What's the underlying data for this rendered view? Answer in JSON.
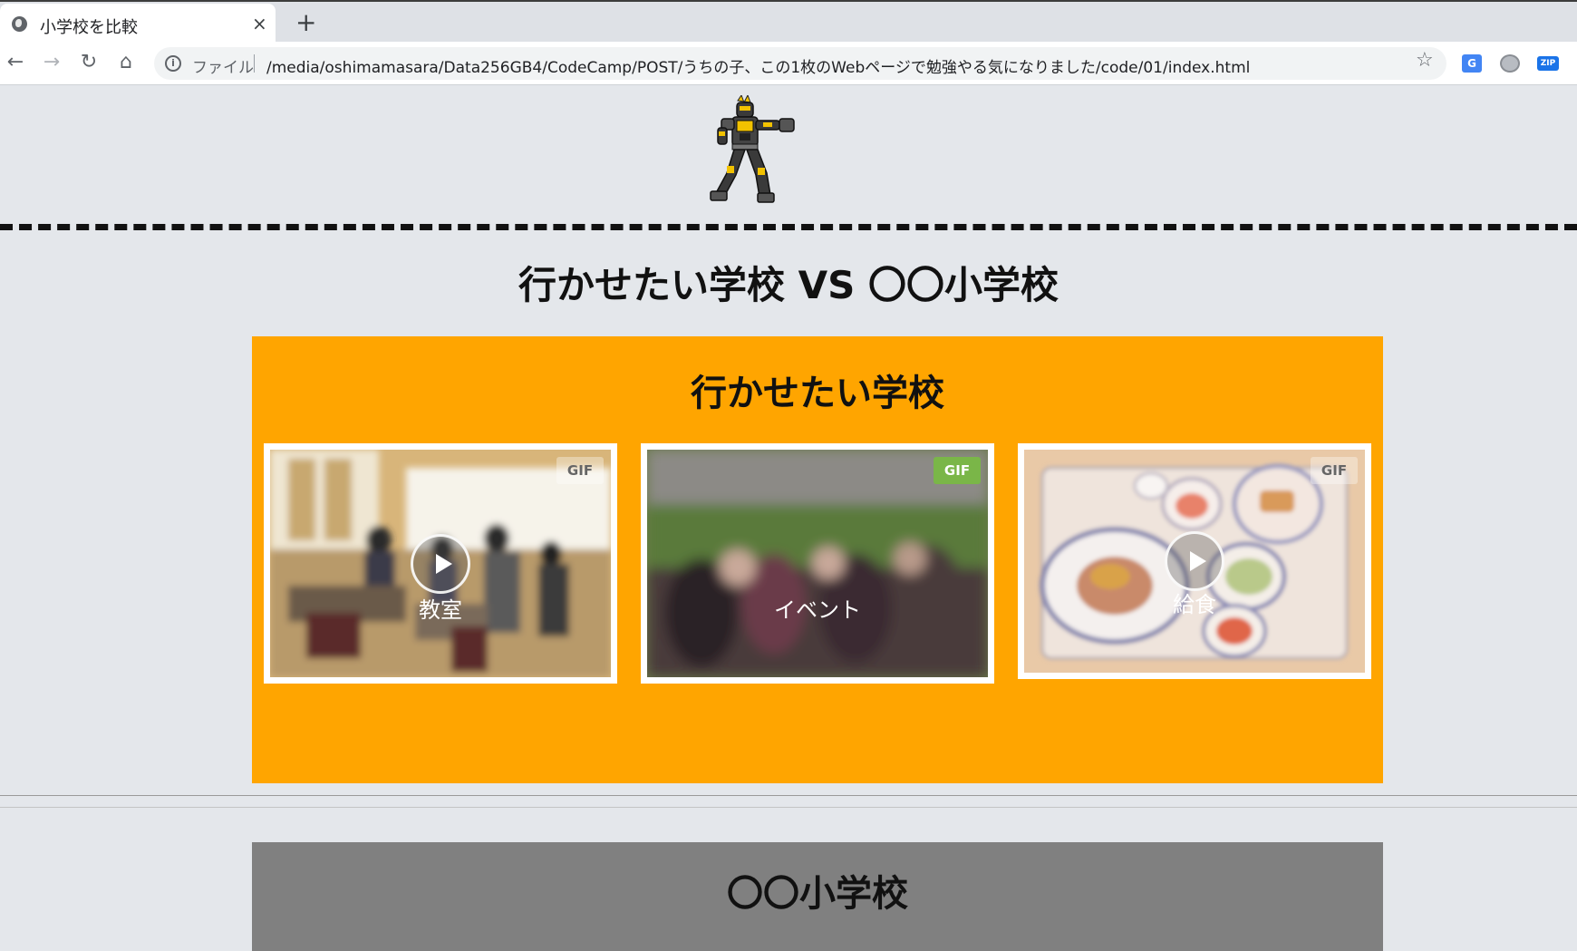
{
  "browser": {
    "tab_title": "小学校を比較",
    "tab_close": "×",
    "new_tab": "+",
    "omnibox_label": "ファイル",
    "url": "/media/oshimamasara/Data256GB4/CodeCamp/POST/うちの子、この1枚のWebページで勉強やる気になりました/code/01/index.html",
    "extensions": [
      "translate-icon",
      "circle-extension-icon",
      "zip-extension-icon"
    ],
    "zip_label": "ZIP"
  },
  "page": {
    "main_title": "行かせたい学校 VS 〇〇小学校",
    "hero_icon": "rider-figure-icon",
    "sections": [
      {
        "title": "行かせたい学校",
        "background": "#ffa500",
        "cards": [
          {
            "label": "教室",
            "badge": "GIF",
            "badge_active": false,
            "has_play": true,
            "scene": "classroom"
          },
          {
            "label": "イベント",
            "badge": "GIF",
            "badge_active": true,
            "has_play": false,
            "scene": "event"
          },
          {
            "label": "給食",
            "badge": "GIF",
            "badge_active": false,
            "has_play": true,
            "scene": "school-lunch"
          }
        ]
      },
      {
        "title": "〇〇小学校",
        "background": "#808080"
      }
    ]
  },
  "colors": {
    "page_bg": "#e4e7eb",
    "accent_orange": "#ffa500",
    "gif_active": "#7ab648",
    "section_gray": "#808080"
  }
}
